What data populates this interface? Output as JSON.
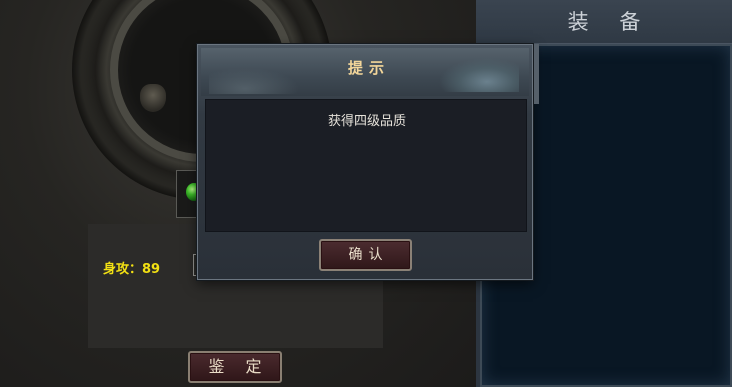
{
  "left_panel": {
    "attack_stat": "身攻：89",
    "identify_button_label": "鉴 定"
  },
  "equipment_panel": {
    "title": "装 备"
  },
  "dialog": {
    "title": "提示",
    "message": "获得四级品质",
    "confirm_label": "确认"
  },
  "colors": {
    "stat_text": "#f2e013",
    "dialog_title": "#f3d69a",
    "button_bg": "#3d2125"
  },
  "icons": [
    "green-gem-icon",
    "ornament-icon"
  ]
}
